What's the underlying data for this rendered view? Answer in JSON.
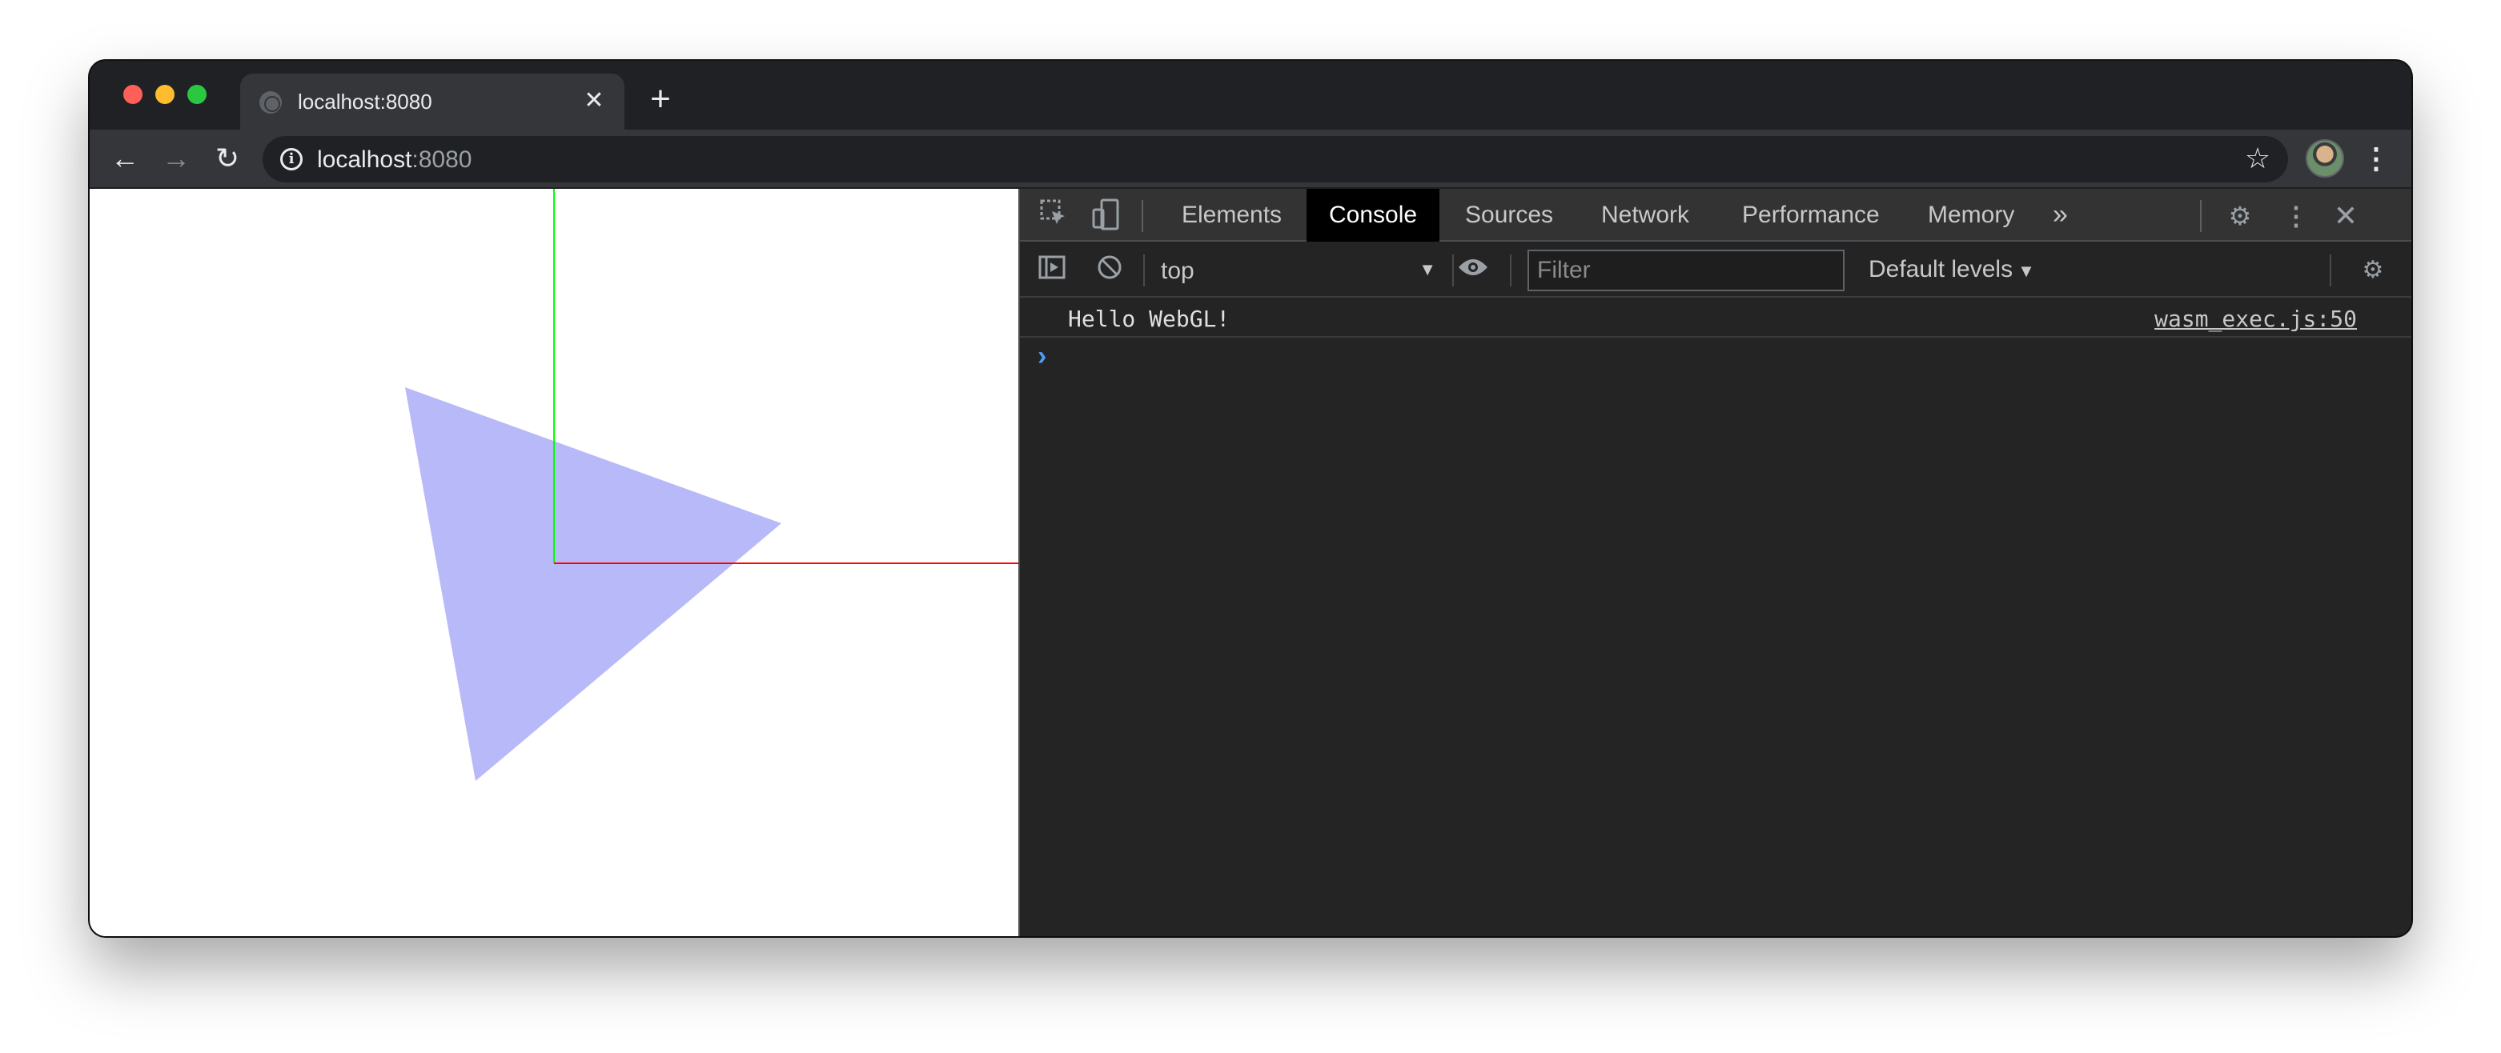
{
  "browser": {
    "tab": {
      "title": "localhost:8080",
      "close": "✕"
    },
    "new_tab": "+",
    "nav": {
      "back": "←",
      "forward": "→",
      "reload": "↻"
    },
    "url": {
      "host": "localhost",
      "port": ":8080"
    },
    "star": "☆",
    "menu": "⋮",
    "info": "i"
  },
  "viewport": {
    "triangle_color": "#b8b9f8",
    "x_axis_color": "#ff0000",
    "y_axis_color": "#00ff00"
  },
  "devtools": {
    "tabs": [
      "Elements",
      "Console",
      "Sources",
      "Network",
      "Performance",
      "Memory"
    ],
    "active_tab": "Console",
    "more": "»",
    "console": {
      "context": "top",
      "filter_placeholder": "Filter",
      "levels": "Default levels",
      "messages": [
        {
          "text": "Hello WebGL!",
          "source": "wasm_exec.js:50"
        }
      ],
      "prompt": "›"
    }
  },
  "icons": {
    "inspect": "inspect-icon",
    "device": "device-toolbar-icon",
    "gear": "gear-icon",
    "close": "close-icon",
    "clear": "clear-console-icon",
    "eye": "live-expression-icon"
  }
}
